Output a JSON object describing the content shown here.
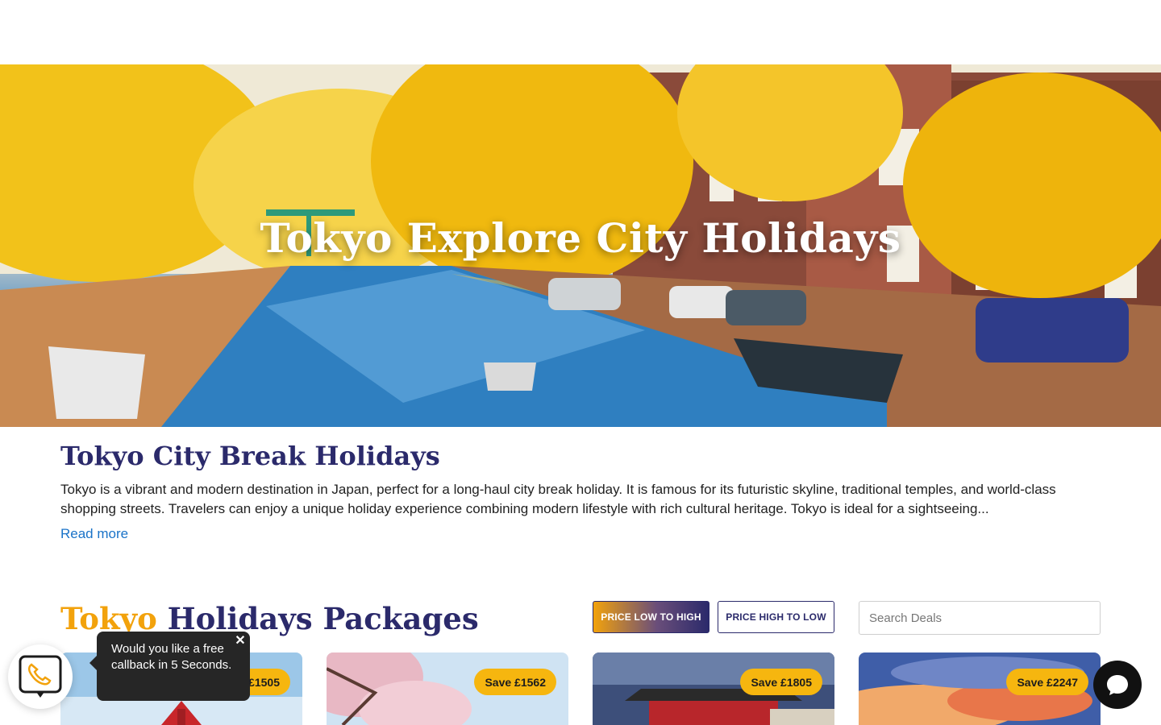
{
  "hero": {
    "title": "Tokyo Explore City Holidays"
  },
  "intro": {
    "heading": "Tokyo City Break Holidays",
    "body": "Tokyo is a vibrant and modern destination in Japan, perfect for a long-haul city break holiday. It is famous for its futuristic skyline, traditional temples, and world-class shopping streets. Travelers can enjoy a unique holiday experience combining modern lifestyle with rich cultural heritage. Tokyo is ideal for a sightseeing...",
    "read_more": "Read more"
  },
  "packages": {
    "title_city": "Tokyo",
    "title_rest": " Holidays Packages",
    "sort_low": "PRICE LOW TO HIGH",
    "sort_high": "PRICE HIGH TO LOW",
    "search_placeholder": "Search Deals",
    "cards": [
      {
        "badge": "Save £1505"
      },
      {
        "badge": "Save £1562"
      },
      {
        "badge": "Save £1805"
      },
      {
        "badge": "Save £2247"
      }
    ]
  },
  "callback": {
    "icon": "phone-chat-icon",
    "message": "Would you like a free callback in 5 Seconds.",
    "close": "✕"
  },
  "chat": {
    "icon": "chat-bubble-icon"
  },
  "colors": {
    "navy": "#2b2a6b",
    "accent": "#f2a20c",
    "badge": "#f6b60f",
    "link": "#1a73c8"
  }
}
